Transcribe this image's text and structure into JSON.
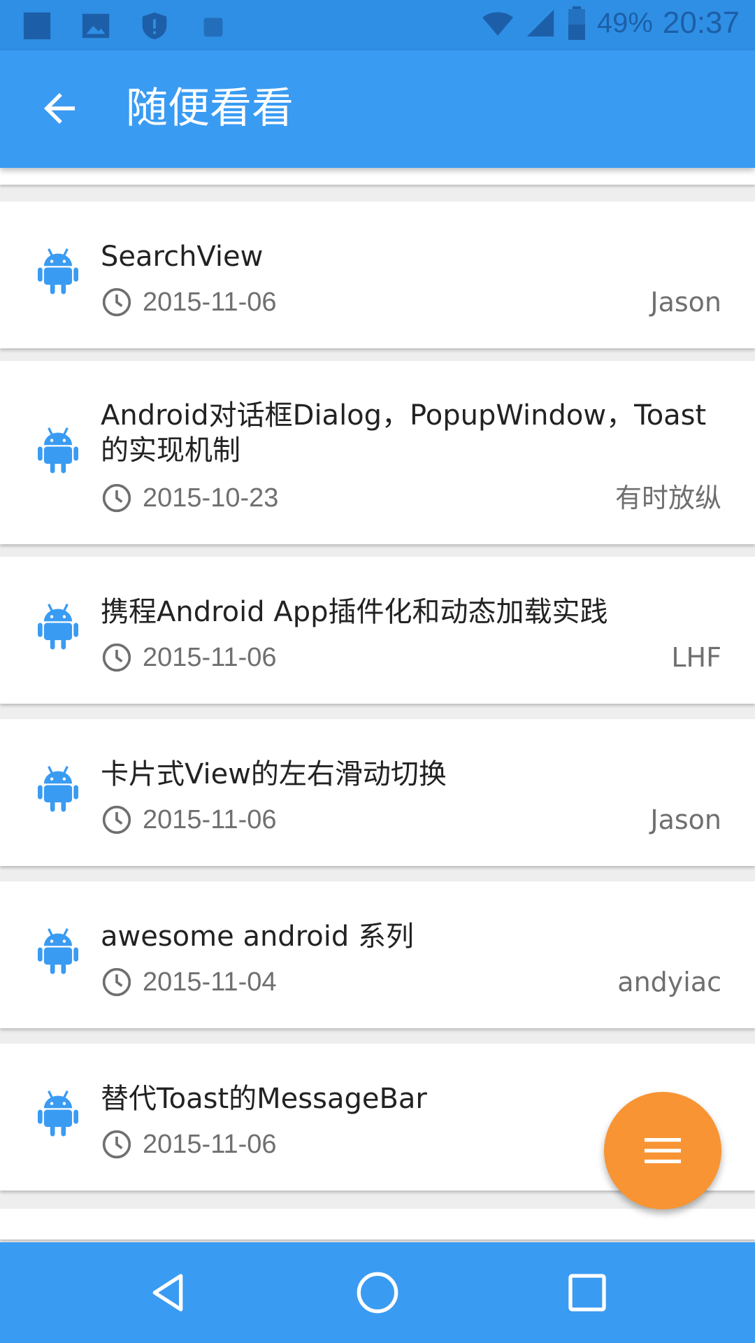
{
  "status_bar": {
    "battery_percent": "49%",
    "time": "20:37",
    "icons": [
      "notification-icon",
      "image-icon",
      "shield-icon",
      "android-icon",
      "wifi-icon",
      "signal-icon",
      "battery-icon"
    ]
  },
  "app_bar": {
    "title": "随便看看",
    "back_icon": "arrow-left-icon"
  },
  "articles": [
    {
      "title": "SearchView",
      "date": "2015-11-06",
      "author": "Jason"
    },
    {
      "title": "Android对话框Dialog，PopupWindow，Toast的实现机制",
      "date": "2015-10-23",
      "author": "有时放纵"
    },
    {
      "title": "携程Android App插件化和动态加载实践",
      "date": "2015-11-06",
      "author": "LHF"
    },
    {
      "title": "卡片式View的左右滑动切换",
      "date": "2015-11-06",
      "author": "Jason"
    },
    {
      "title": "awesome android 系列",
      "date": "2015-11-04",
      "author": "andyiac"
    },
    {
      "title": "替代Toast的MessageBar",
      "date": "2015-11-06",
      "author": ""
    }
  ],
  "fab": {
    "icon": "menu-icon"
  },
  "nav_bar": {
    "icons": [
      "nav-back-icon",
      "nav-home-icon",
      "nav-recents-icon"
    ]
  },
  "colors": {
    "primary": "#3a9bf2",
    "status_bar": "#2f8fe5",
    "accent": "#f89433",
    "android_icon": "#3a9bf2",
    "background": "#eeeeee"
  }
}
